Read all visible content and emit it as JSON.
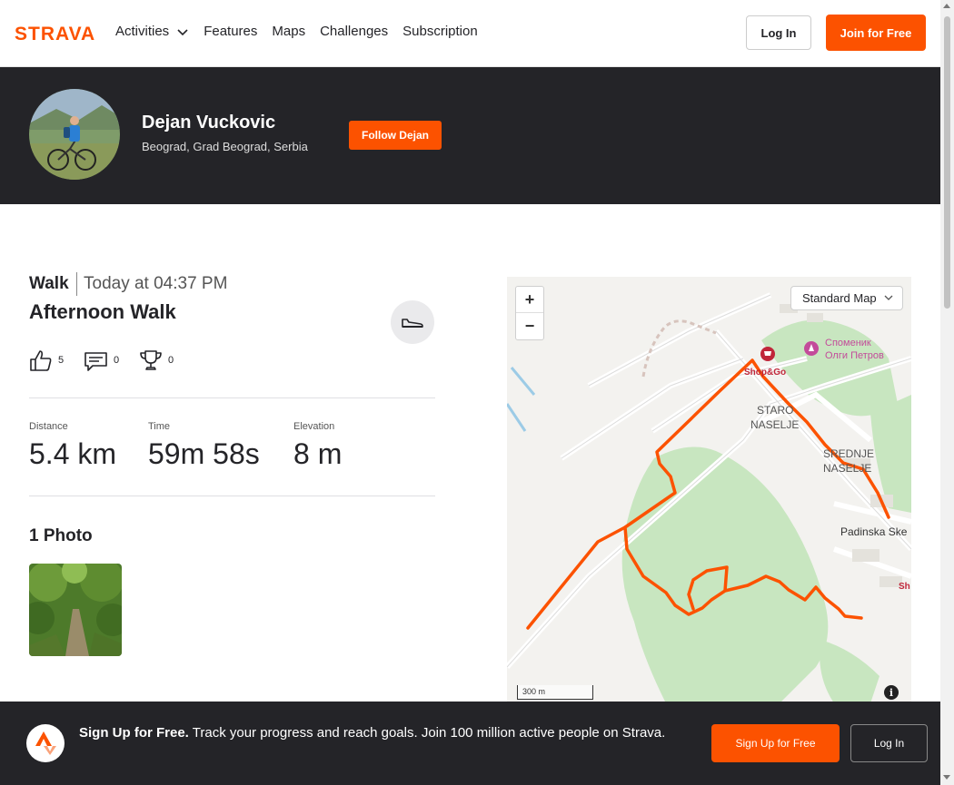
{
  "nav": {
    "logo_text": "STRAVA",
    "items": [
      "Activities",
      "Features",
      "Maps",
      "Challenges",
      "Subscription"
    ],
    "login_label": "Log In",
    "join_label": "Join for Free"
  },
  "athlete": {
    "name": "Dejan Vuckovic",
    "location": "Beograd, Grad Beograd, Serbia",
    "follow_label": "Follow Dejan"
  },
  "activity": {
    "type": "Walk",
    "datetime": "Today at 04:37 PM",
    "title": "Afternoon Walk",
    "kudos": "5",
    "comments": "0",
    "achievements": "0",
    "stats": [
      {
        "label": "Distance",
        "value": "5.4 km"
      },
      {
        "label": "Time",
        "value": "59m 58s"
      },
      {
        "label": "Elevation",
        "value": "8 m"
      }
    ],
    "photos_title": "1 Photo"
  },
  "map": {
    "map_type": "Standard Map",
    "scale_label": "300 m",
    "labels": {
      "shop": "Shop&Go",
      "monument_1": "Споменик",
      "monument_2": "Олги Петров",
      "area1_1": "STARO",
      "area1_2": "NASELJE",
      "area2_1": "SREDNJE",
      "area2_2": "NASELJE",
      "padinska": "Padinska Ske",
      "sh": "Sh"
    },
    "route_color": "#fc5200"
  },
  "signup": {
    "headline": "Sign Up for Free.",
    "text": "Track your progress and reach goals. Join 100 million active people on Strava.",
    "signup_label": "Sign Up for Free",
    "login_label": "Log In"
  },
  "colors": {
    "brand": "#fc5200",
    "dark": "#242428"
  }
}
